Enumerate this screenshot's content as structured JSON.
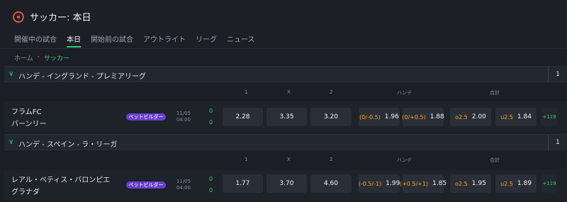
{
  "header": {
    "title": "サッカー: 本日",
    "ball_icon": "soccer-ball-icon",
    "accent": "#2ecc71"
  },
  "tabs": [
    "開催中の試合",
    "本日",
    "開始前の試合",
    "アウトライト",
    "リーグ",
    "ニュース"
  ],
  "breadcrumb": {
    "home": "ホーム",
    "sep": "-",
    "current": "サッカー"
  },
  "col_labels": {
    "one": "1",
    "x": "X",
    "two": "2",
    "handicap": "ハンデ",
    "total": "合計"
  },
  "leagues": [
    {
      "name": "ハンデ - イングランド - プレミアリーグ",
      "count": "1",
      "match": {
        "home": "フラムFC",
        "away": "バーンリー",
        "badge": "ベットビルダー",
        "date": "11/05",
        "time": "04:00",
        "score_home": "0",
        "score_away": "0",
        "odds_1": "2.28",
        "odds_x": "3.35",
        "odds_2": "3.20",
        "hcp_home_label": "(0/-0.5)",
        "hcp_home_odds": "1.96",
        "hcp_away_label": "(0/+0.5)",
        "hcp_away_odds": "1.88",
        "over_label": "o2.5",
        "over_odds": "2.00",
        "under_label": "u2.5",
        "under_odds": "1.84",
        "more": "+119"
      }
    },
    {
      "name": "ハンデ - スペイン - ラ・リーガ",
      "count": "1",
      "match": {
        "home": "レアル・ベティス・バロンピエ",
        "away": "グラナダ",
        "badge": "ベットビルダー",
        "date": "11/05",
        "time": "04:00",
        "score_home": "0",
        "score_away": "0",
        "odds_1": "1.77",
        "odds_x": "3.70",
        "odds_2": "4.60",
        "hcp_home_label": "(-0.5/-1)",
        "hcp_home_odds": "1.99",
        "hcp_away_label": "(+0.5/+1)",
        "hcp_away_odds": "1.85",
        "over_label": "o2.5",
        "over_odds": "1.95",
        "under_label": "u2.5",
        "under_odds": "1.89",
        "more": "+119"
      }
    }
  ]
}
